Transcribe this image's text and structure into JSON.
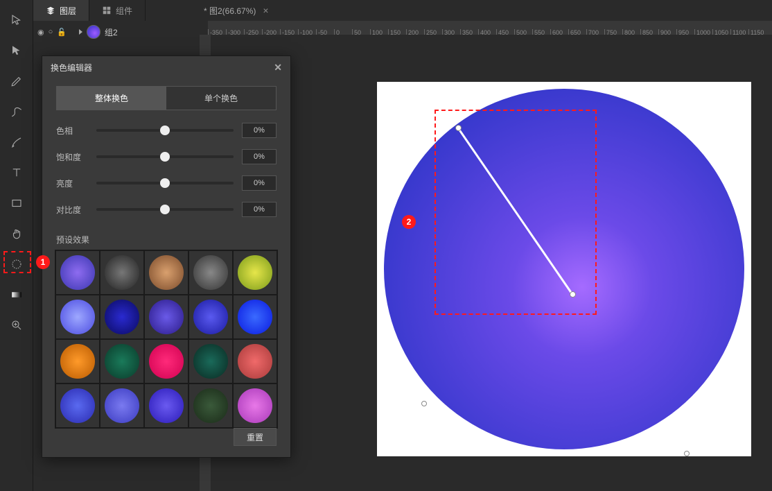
{
  "panel_tabs": {
    "layers": "图层",
    "components": "组件"
  },
  "file_tab": {
    "name": "* 图2(66.67%)"
  },
  "layer": {
    "name": "组2"
  },
  "ruler_ticks": [
    "-350",
    "-300",
    "-250",
    "-200",
    "-150",
    "-100",
    "-50",
    "0",
    "50",
    "100",
    "150",
    "200",
    "250",
    "300",
    "350",
    "400",
    "450",
    "500",
    "550",
    "600",
    "650",
    "700",
    "750",
    "800",
    "850",
    "900",
    "950",
    "1000",
    "1050",
    "1100",
    "1150"
  ],
  "editor": {
    "title": "换色编辑器",
    "tab_overall": "整体换色",
    "tab_single": "单个换色",
    "sliders": [
      {
        "label": "色相",
        "value": "0%",
        "pos": 50
      },
      {
        "label": "饱和度",
        "value": "0%",
        "pos": 50
      },
      {
        "label": "亮度",
        "value": "0%",
        "pos": 50
      },
      {
        "label": "对比度",
        "value": "0%",
        "pos": 50
      }
    ],
    "presets_label": "预设效果",
    "reset": "重置",
    "presets": [
      "radial-gradient(circle at 50% 50%, #8e6cf0, #3a36b0)",
      "radial-gradient(circle at 50% 50%, #777, #222)",
      "radial-gradient(circle at 50% 50%, #d9a06e, #7a4a2a)",
      "radial-gradient(circle at 50% 50%, #888, #333)",
      "radial-gradient(circle at 50% 50%, #e6e64a, #7a9a1a)",
      "radial-gradient(circle at 50% 50%, #9ea8ff, #4a4ae0)",
      "radial-gradient(circle at 50% 50%, #2a2ad0, #0a0a60)",
      "radial-gradient(circle at 50% 50%, #6a5ae8, #2a1a88)",
      "radial-gradient(circle at 50% 50%, #5a5af0, #1a1aa0)",
      "radial-gradient(circle at 50% 50%, #3a6aff, #0a1ae0)",
      "radial-gradient(circle at 50% 50%, #ff9a2a, #b85a00)",
      "radial-gradient(circle at 50% 50%, #1a7a5a, #0a3a2a)",
      "radial-gradient(circle at 50% 50%, #ff2a7a, #d00050)",
      "radial-gradient(circle at 50% 50%, #1a6a5a, #0a2a22)",
      "radial-gradient(circle at 50% 50%, #f06a6a, #a83a3a)",
      "radial-gradient(circle at 50% 50%, #5a6af0, #2a2ab0)",
      "radial-gradient(circle at 50% 50%, #7a7af0, #3a3ac0)",
      "radial-gradient(circle at 50% 50%, #6a5af0, #2a1ab8)",
      "radial-gradient(circle at 50% 50%, #3a5a3a, #1a2a18)",
      "radial-gradient(circle at 50% 50%, #e878e8, #a838b8)"
    ]
  },
  "annotations": {
    "one": "1",
    "two": "2"
  }
}
